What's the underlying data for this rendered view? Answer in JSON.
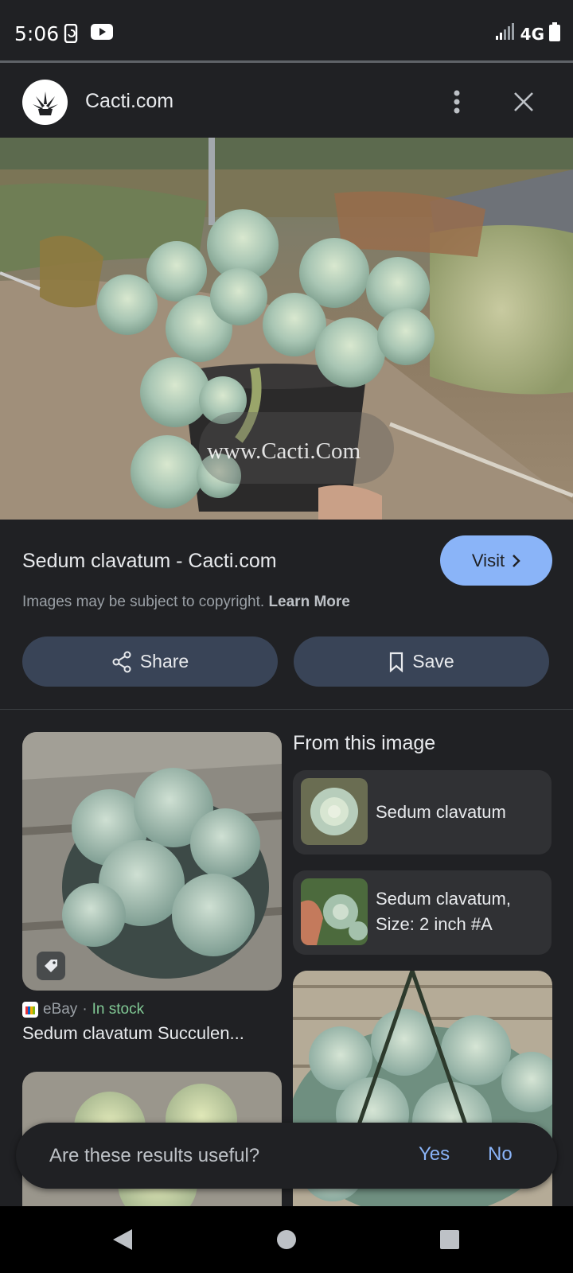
{
  "status_bar": {
    "time": "5:06",
    "network": "4G"
  },
  "header": {
    "site_name": "Cacti.com",
    "logo_icon": "agave-logo-icon",
    "more_icon": "more-vert-icon",
    "close_icon": "close-icon"
  },
  "hero": {
    "watermark": "www.Cacti.Com"
  },
  "result": {
    "title": "Sedum clavatum - Cacti.com",
    "visit_label": "Visit",
    "copyright_text": "Images may be subject to copyright.",
    "learn_more": "Learn More",
    "share_label": "Share",
    "save_label": "Save"
  },
  "related": {
    "source": "eBay",
    "separator": "·",
    "availability": "In stock",
    "product_title": "Sedum clavatum Succulen..."
  },
  "from_image": {
    "heading": "From this image",
    "items": [
      {
        "label": "Sedum clavatum"
      },
      {
        "label_line1": "Sedum clavatum,",
        "label_line2": "Size: 2 inch #A"
      }
    ]
  },
  "feedback": {
    "question": "Are these results useful?",
    "yes": "Yes",
    "no": "No"
  },
  "colors": {
    "background": "#202124",
    "accent_blue": "#8ab4f8",
    "button_bg": "#394457",
    "in_stock_green": "#81c995"
  }
}
